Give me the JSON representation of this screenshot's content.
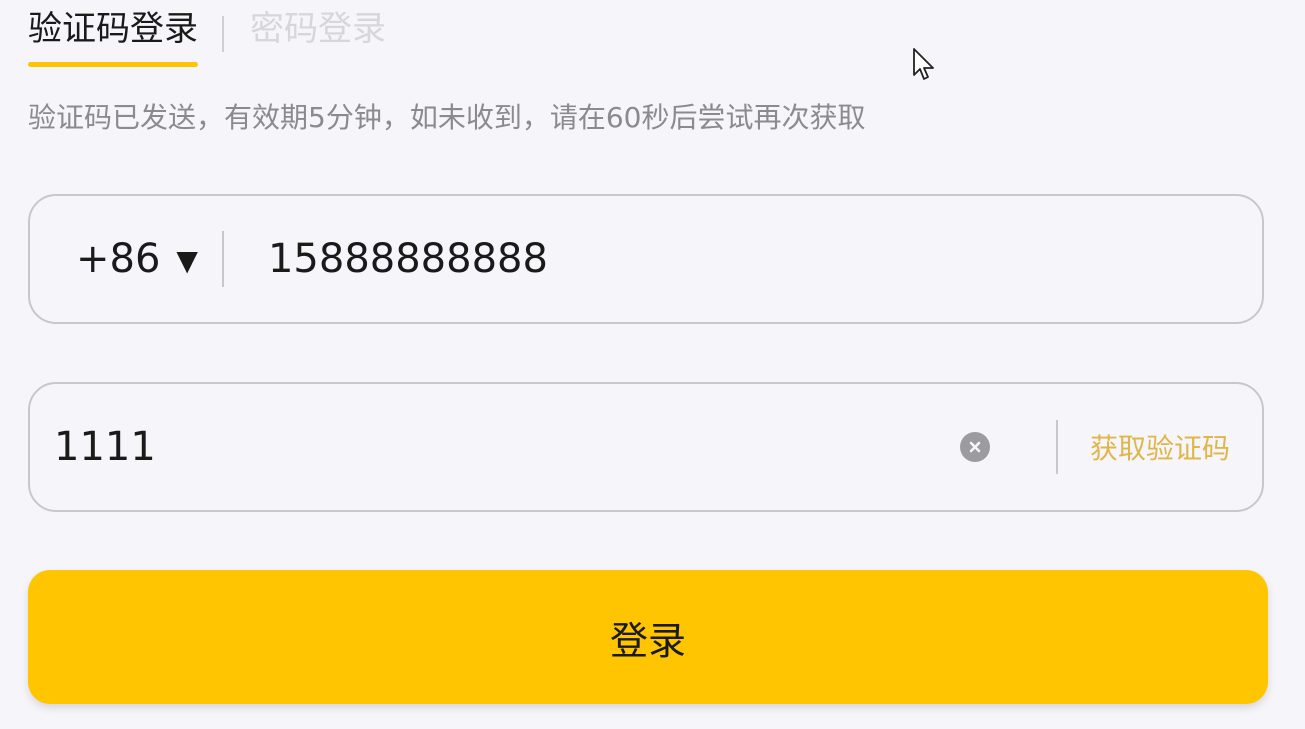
{
  "tabs": {
    "sms_login": "验证码登录",
    "password_login": "密码登录"
  },
  "hint": "验证码已发送，有效期5分钟，如未收到，请在60秒后尝试再次获取",
  "phone_field": {
    "country_code": "+86",
    "arrow_icon": "dropdown-triangle-icon",
    "value": "15888888888"
  },
  "code_field": {
    "value": "1111",
    "clear_icon": "clear-icon",
    "get_code_label": "获取验证码"
  },
  "login_button": {
    "label": "登录"
  },
  "colors": {
    "accent": "#ffc500",
    "get_code_text": "#e0b64a",
    "background": "#f5f5fa",
    "inactive_tab": "#d6d6dc",
    "hint_text": "#8a8a90"
  }
}
